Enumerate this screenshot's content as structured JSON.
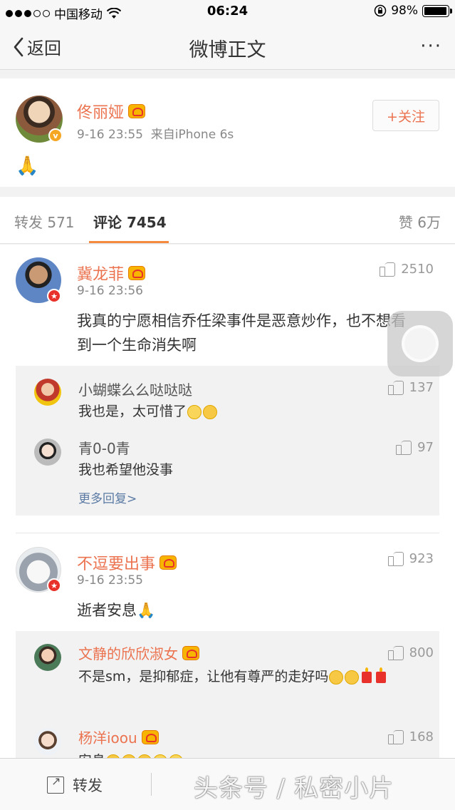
{
  "status_bar": {
    "carrier": "中国移动",
    "time": "06:24",
    "battery": "98%",
    "battery_level": 0.98
  },
  "nav": {
    "back_label": "返回",
    "title": "微博正文",
    "more": "···"
  },
  "post": {
    "author": "佟丽娅",
    "meta": "9-16 23:55  来自iPhone 6s",
    "follow_label": "+关注",
    "content": "🙏"
  },
  "tabs": {
    "repost": "转发 571",
    "comment": "评论 7454",
    "like": "赞 6万"
  },
  "comments": [
    {
      "user": "冀龙菲",
      "time": "9-16 23:56",
      "likes": "2510",
      "text_line1": "我真的宁愿相信乔任梁事件是恶意炒作，也不想看",
      "text_line2": "到一个生命消失啊",
      "replies": [
        {
          "user": "小蝴蝶么么哒哒哒",
          "text": "我也是，太可惜了",
          "likes": "137"
        },
        {
          "user": "青0-0青",
          "text": "我也希望他没事",
          "likes": "97"
        }
      ],
      "more_replies": "更多回复>"
    },
    {
      "user": "不逗要出事",
      "time": "9-16 23:55",
      "likes": "923",
      "text": "逝者安息🙏",
      "replies": [
        {
          "user": "文静的欣欣淑女",
          "text": "不是sm，是抑郁症，让他有尊严的走好吗",
          "likes": "800"
        },
        {
          "user": "杨洋ioou",
          "text": "安息",
          "likes": "168"
        }
      ]
    }
  ],
  "toolbar": {
    "repost_label": "转发",
    "watermark": "头条号 / 私密小片"
  },
  "colors": {
    "accent": "#eb7350",
    "tab_indicator": "#f58a3e",
    "link": "#5a7aa4"
  }
}
